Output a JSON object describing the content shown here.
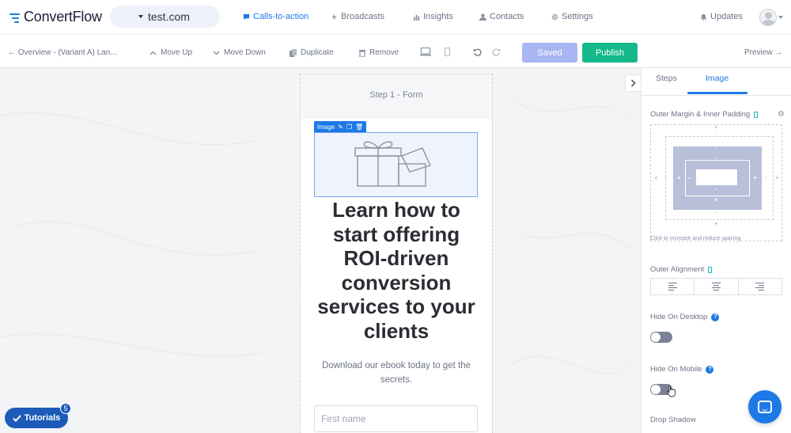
{
  "app": {
    "brand_name": "ConvertFlow",
    "site_name": "test.com"
  },
  "nav": {
    "items": [
      {
        "label": "Calls-to-action",
        "icon": "chat-bubble-icon",
        "active": true
      },
      {
        "label": "Broadcasts",
        "icon": "bolt-icon",
        "active": false
      },
      {
        "label": "Insights",
        "icon": "bar-chart-icon",
        "active": false
      },
      {
        "label": "Contacts",
        "icon": "person-icon",
        "active": false
      },
      {
        "label": "Settings",
        "icon": "gear-icon",
        "active": false
      }
    ],
    "updates_label": "Updates"
  },
  "toolbar": {
    "back_label": "← Overview - (Variant A) Lan...",
    "move_up": "Move Up",
    "move_down": "Move Down",
    "duplicate": "Duplicate",
    "remove": "Remove",
    "saved": "Saved",
    "publish": "Publish",
    "preview": "Preview →"
  },
  "canvas": {
    "step_label": "Step 1 - Form",
    "image_tag": "Image",
    "headline": "Learn how to start offering ROI-driven conversion services to your clients",
    "subtext": "Download our ebook today to get the secrets.",
    "first_name_placeholder": "First name"
  },
  "tutorials": {
    "label": "Tutorials",
    "badge": "5"
  },
  "sidebar": {
    "tabs": [
      {
        "label": "Steps",
        "active": false
      },
      {
        "label": "Image",
        "active": true
      }
    ],
    "spacing_title": "Outer Margin & Inner Padding",
    "spacing_caption": "Click to increase and reduce spacing",
    "alignment_title": "Outer Alignment",
    "hide_desktop_title": "Hide On Desktop",
    "hide_desktop_on": false,
    "hide_mobile_title": "Hide On Mobile",
    "hide_mobile_on": false,
    "drop_shadow_title": "Drop Shadow"
  },
  "colors": {
    "primary": "#1c79e6",
    "publish": "#15b88a",
    "saved": "#a8b6f2"
  }
}
